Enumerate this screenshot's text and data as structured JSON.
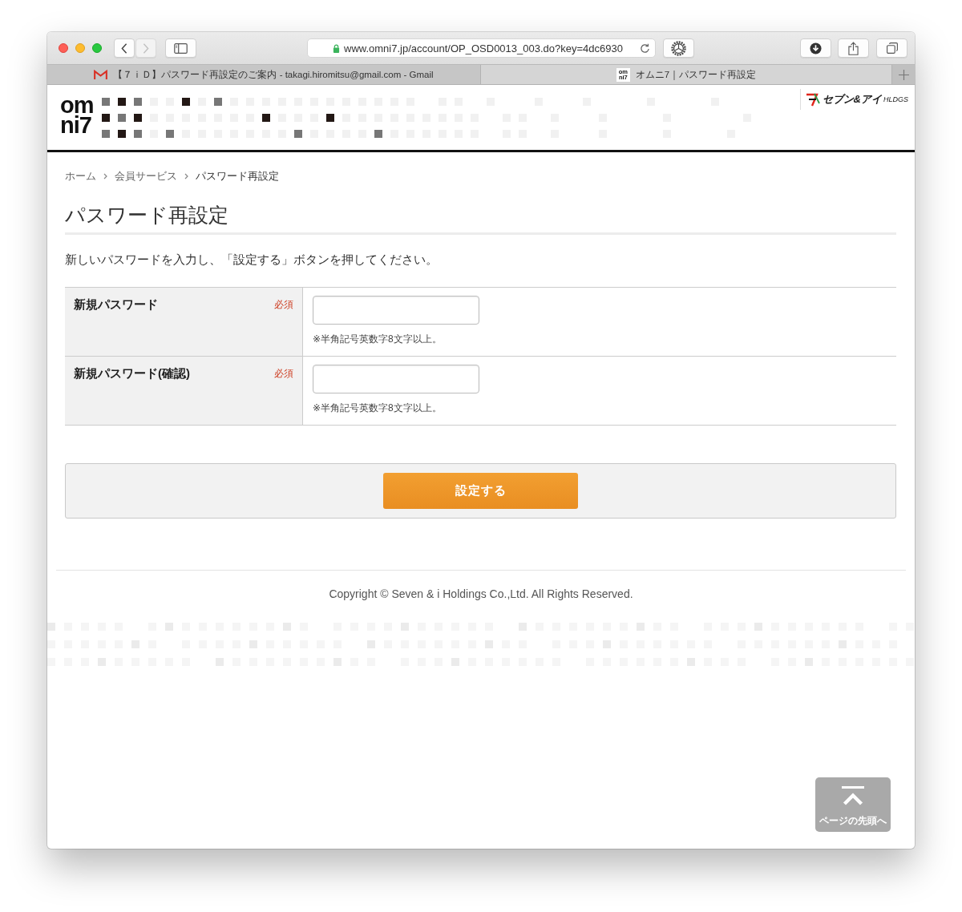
{
  "browser": {
    "nav_buttons": [
      {
        "kind": "back",
        "disabled": false
      },
      {
        "kind": "forward",
        "disabled": true
      }
    ],
    "address": {
      "secure": true,
      "url": "www.omni7.jp/account/OP_OSD0013_003.do?key=4dc6930"
    },
    "tabs": [
      {
        "kind": "mail",
        "title": "【７ｉＤ】パスワード再設定のご案内 - takagi.hiromitsu@gmail.com - Gmail",
        "selected": false
      },
      {
        "kind": "site",
        "favicon_lines": [
          "om",
          "ni7"
        ],
        "title": "オムニ7｜パスワード再設定",
        "selected": true
      }
    ]
  },
  "header": {
    "logo": {
      "lines": [
        "om",
        "ni7"
      ]
    },
    "group_logo": {
      "name": "セブン&アイ",
      "suffix": "HLDGS"
    }
  },
  "breadcrumb": [
    {
      "label": "ホーム",
      "current": false
    },
    {
      "label": "会員サービス",
      "current": false
    },
    {
      "label": "パスワード再設定",
      "current": true
    }
  ],
  "title": "パスワード再設定",
  "instruction": "新しいパスワードを入力し、「設定する」ボタンを押してください。",
  "form": {
    "fields": [
      {
        "label": "新規パスワード",
        "required": true,
        "required_label": "必須",
        "hint": "※半角記号英数字8文字以上。"
      },
      {
        "label": "新規パスワード(確認)",
        "required": true,
        "required_label": "必須",
        "hint": "※半角記号英数字8文字以上。"
      }
    ],
    "submit_label": "設定する"
  },
  "footer": {
    "copyright": "Copyright © Seven & i Holdings Co.,Ltd. All Rights Reserved."
  },
  "back_to_top": {
    "label": "ページの先頭へ"
  }
}
